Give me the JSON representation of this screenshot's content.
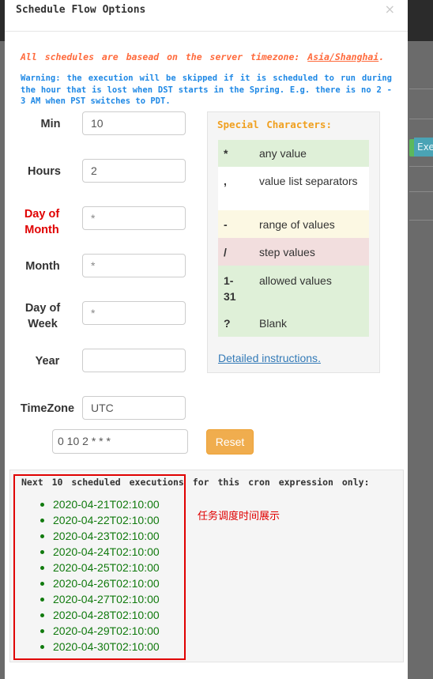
{
  "modal": {
    "title": "Schedule Flow Options",
    "close_glyph": "×",
    "timezone_note_prefix": "All schedules are basead on the server timezone: ",
    "timezone_note_value": "Asia/Shanghai",
    "timezone_note_suffix": ".",
    "warning": "Warning: the execution will be skipped if it is scheduled to run during the hour that is lost when DST starts in the Spring. E.g. there is no 2 - 3 AM when PST switches to PDT."
  },
  "fields": {
    "min": {
      "label": "Min",
      "value": "10"
    },
    "hours": {
      "label": "Hours",
      "value": "2"
    },
    "day_of_month": {
      "label": "Day of Month",
      "value": "*"
    },
    "month": {
      "label": "Month",
      "value": "*"
    },
    "day_of_week": {
      "label": "Day of Week",
      "value": "*"
    },
    "year": {
      "label": "Year",
      "value": ""
    },
    "timezone": {
      "label": "TimeZone",
      "value": "UTC"
    }
  },
  "cron_expression": "0 10 2 * * *",
  "reset_label": "Reset",
  "special_characters": {
    "title": "Special Characters:",
    "rows": [
      {
        "symbol": "*",
        "desc": "any value",
        "color": "#dff0d8"
      },
      {
        "symbol": ",",
        "desc": "value list separators",
        "color": "#ffffff"
      },
      {
        "symbol": "-",
        "desc": "range of values",
        "color": "#fcf8e3"
      },
      {
        "symbol": "/",
        "desc": "step values",
        "color": "#f2dede"
      },
      {
        "symbol": "1-31",
        "desc": "allowed values",
        "color": "#dff0d8"
      },
      {
        "symbol": "?",
        "desc": "Blank",
        "color": "#dff0d8"
      }
    ],
    "detailed_link": "Detailed instructions",
    "detailed_suffix": "."
  },
  "executions": {
    "title": "Next 10 scheduled executions for this cron expression only:",
    "items": [
      "2020-04-21T02:10:00",
      "2020-04-22T02:10:00",
      "2020-04-23T02:10:00",
      "2020-04-24T02:10:00",
      "2020-04-25T02:10:00",
      "2020-04-26T02:10:00",
      "2020-04-27T02:10:00",
      "2020-04-28T02:10:00",
      "2020-04-29T02:10:00",
      "2020-04-30T02:10:00"
    ]
  },
  "annotation": "任务调度时间展示",
  "background": {
    "button_label": "Exe"
  }
}
